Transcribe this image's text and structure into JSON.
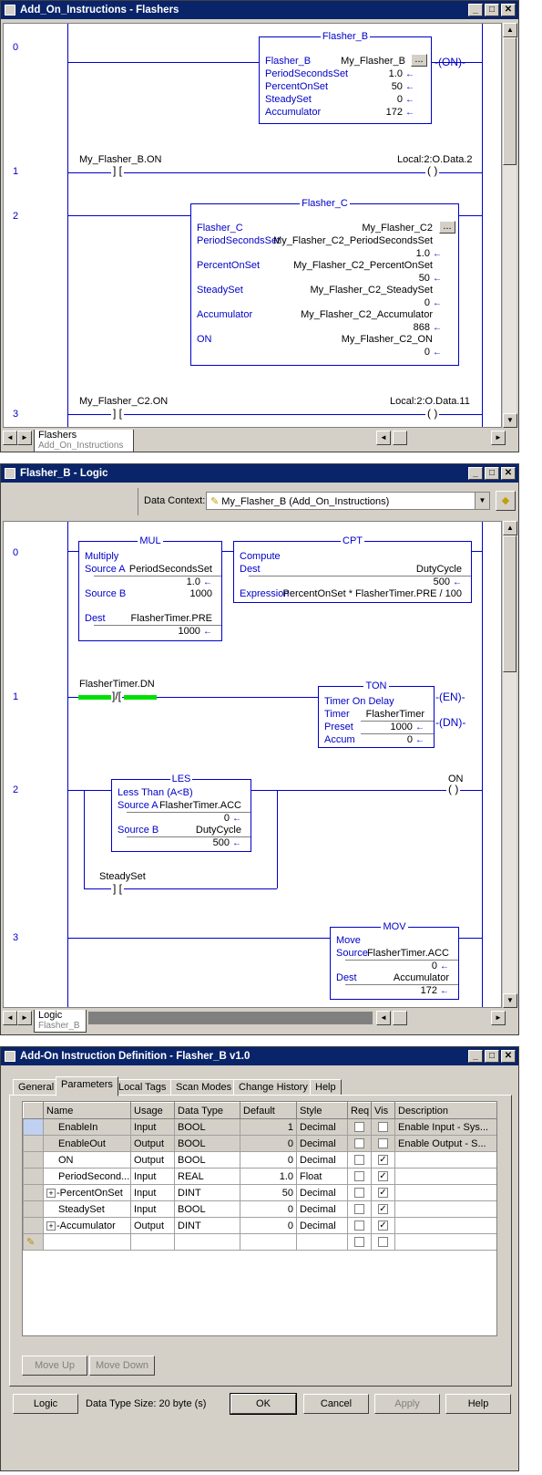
{
  "win1": {
    "title": "Add_On_Instructions - Flashers",
    "rungs": [
      "0",
      "1",
      "2",
      "3"
    ],
    "flasherB": {
      "title": "Flasher_B",
      "rows": [
        {
          "label": "Flasher_B",
          "value": "My_Flasher_B"
        },
        {
          "label": "PeriodSecondsSet",
          "value": "1.0"
        },
        {
          "label": "PercentOnSet",
          "value": "50"
        },
        {
          "label": "SteadySet",
          "value": "0"
        },
        {
          "label": "Accumulator",
          "value": "172"
        }
      ],
      "coil": "ON",
      "browse": "..."
    },
    "rung1": {
      "contact": "My_Flasher_B.ON",
      "coil": "Local:2:O.Data.2"
    },
    "flasherC": {
      "title": "Flasher_C",
      "browse": "...",
      "rows": [
        {
          "label": "Flasher_C",
          "tag": "My_Flasher_C2",
          "value": ""
        },
        {
          "label": "PeriodSecondsSet",
          "tag": "My_Flasher_C2_PeriodSecondsSet",
          "value": "1.0"
        },
        {
          "label": "PercentOnSet",
          "tag": "My_Flasher_C2_PercentOnSet",
          "value": "50"
        },
        {
          "label": "SteadySet",
          "tag": "My_Flasher_C2_SteadySet",
          "value": "0"
        },
        {
          "label": "Accumulator",
          "tag": "My_Flasher_C2_Accumulator",
          "value": "868"
        },
        {
          "label": "ON",
          "tag": "My_Flasher_C2_ON",
          "value": "0"
        }
      ]
    },
    "rung3": {
      "contact": "My_Flasher_C2.ON",
      "coil": "Local:2:O.Data.11"
    },
    "tab": {
      "name": "Flashers",
      "sub": "Add_On_Instructions"
    }
  },
  "win2": {
    "title": "Flasher_B - Logic",
    "context_label": "Data Context:",
    "context_value": "My_Flasher_B (Add_On_Instructions)",
    "rungs": [
      "0",
      "1",
      "2",
      "3"
    ],
    "mul": {
      "title": "MUL",
      "name": "Multiply",
      "srcA_label": "Source A",
      "srcA": "PeriodSecondsSet",
      "srcA_val": "1.0",
      "srcB_label": "Source B",
      "srcB": "1000",
      "dest_label": "Dest",
      "dest": "FlasherTimer.PRE",
      "dest_val": "1000"
    },
    "cpt": {
      "title": "CPT",
      "name": "Compute",
      "dest_label": "Dest",
      "dest": "DutyCycle",
      "dest_val": "500",
      "expr_label": "Expression",
      "expr": "PercentOnSet * FlasherTimer.PRE / 100"
    },
    "rung1_contact": "FlasherTimer.DN",
    "ton": {
      "title": "TON",
      "name": "Timer On Delay",
      "timer_label": "Timer",
      "timer": "FlasherTimer",
      "preset_label": "Preset",
      "preset": "1000",
      "accum_label": "Accum",
      "accum": "0",
      "en": "EN",
      "dn": "DN"
    },
    "les": {
      "title": "LES",
      "name": "Less Than (A<B)",
      "srcA_label": "Source A",
      "srcA": "FlasherTimer.ACC",
      "srcA_val": "0",
      "srcB_label": "Source B",
      "srcB": "DutyCycle",
      "srcB_val": "500"
    },
    "rung2_coil": "ON",
    "rung2_contact": "SteadySet",
    "mov": {
      "title": "MOV",
      "name": "Move",
      "src_label": "Source",
      "src": "FlasherTimer.ACC",
      "src_val": "0",
      "dest_label": "Dest",
      "dest": "Accumulator",
      "dest_val": "172"
    },
    "tab": {
      "name": "Logic",
      "sub": "Flasher_B"
    }
  },
  "win3": {
    "title": "Add-On Instruction Definition - Flasher_B v1.0",
    "tabs": [
      "General",
      "Parameters",
      "Local Tags",
      "Scan Modes",
      "Change History",
      "Help"
    ],
    "columns": [
      "",
      "Name",
      "Usage",
      "Data Type",
      "Default",
      "Style",
      "Req",
      "Vis",
      "Description"
    ],
    "rows": [
      {
        "expand": "",
        "name": "EnableIn",
        "usage": "Input",
        "type": "BOOL",
        "default": "1",
        "style": "Decimal",
        "req": false,
        "vis": false,
        "desc": "Enable Input - Sys...",
        "grey": true
      },
      {
        "expand": "",
        "name": "EnableOut",
        "usage": "Output",
        "type": "BOOL",
        "default": "0",
        "style": "Decimal",
        "req": false,
        "vis": false,
        "desc": "Enable Output - S...",
        "grey": true
      },
      {
        "expand": "",
        "name": "ON",
        "usage": "Output",
        "type": "BOOL",
        "default": "0",
        "style": "Decimal",
        "req": false,
        "vis": true,
        "desc": "",
        "grey": false
      },
      {
        "expand": "",
        "name": "PeriodSecond...",
        "usage": "Input",
        "type": "REAL",
        "default": "1.0",
        "style": "Float",
        "req": false,
        "vis": true,
        "desc": "",
        "grey": false
      },
      {
        "expand": "+",
        "name": "PercentOnSet",
        "usage": "Input",
        "type": "DINT",
        "default": "50",
        "style": "Decimal",
        "req": false,
        "vis": true,
        "desc": "",
        "grey": false
      },
      {
        "expand": "",
        "name": "SteadySet",
        "usage": "Input",
        "type": "BOOL",
        "default": "0",
        "style": "Decimal",
        "req": false,
        "vis": true,
        "desc": "",
        "grey": false
      },
      {
        "expand": "+",
        "name": "Accumulator",
        "usage": "Output",
        "type": "DINT",
        "default": "0",
        "style": "Decimal",
        "req": false,
        "vis": true,
        "desc": "",
        "grey": false
      }
    ],
    "buttons": {
      "move_up": "Move Up",
      "move_down": "Move Down",
      "logic": "Logic",
      "ok": "OK",
      "cancel": "Cancel",
      "apply": "Apply",
      "help": "Help"
    },
    "size_text": "Data Type Size: 20 byte (s)"
  }
}
